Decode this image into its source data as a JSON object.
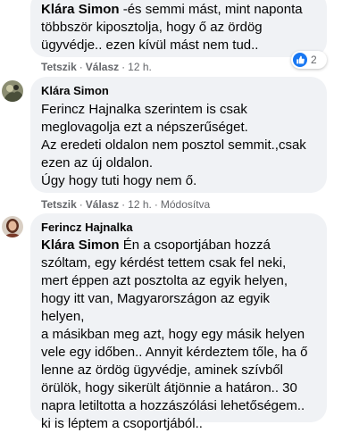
{
  "comments": [
    {
      "author": "Klára Simon",
      "first_line_rest": " -és semmi mást, mint naponta",
      "lines": [
        "többször kiposztolja, hogy ő az ördög",
        "ügyvédje.. ezen kívül mást nem tud.."
      ],
      "actions": {
        "like": "Tetszik",
        "reply": "Válasz",
        "time": "12 h."
      },
      "reaction": {
        "icon": "thumbs-up-icon",
        "count": "2"
      }
    },
    {
      "author": "Klára Simon",
      "lines": [
        "Ferincz Hajnalka szerintem is csak",
        "meglovagolja ezt a népszerűséget.",
        "Az eredeti oldalon nem posztol semmit.,csak",
        "ezen az új oldalon.",
        "Úgy hogy tuti hogy nem ő."
      ],
      "actions": {
        "like": "Tetszik",
        "reply": "Válasz",
        "time": "12 h.",
        "edited": "Módosítva"
      }
    },
    {
      "author": "Ferincz Hajnalka",
      "mention": "Klára Simon",
      "first_line_rest": " Én a csoportjában hozzá",
      "lines": [
        "szóltam, egy kérdést tettem csak fel neki,",
        "mert éppen azt posztolta az egyik helyen,",
        "hogy itt van, Magyarországon az egyik helyen,",
        "a másikban meg azt, hogy egy másik helyen",
        "vele egy időben.. Annyit kérdeztem tőle, ha ő",
        "lenne az ördög ügyvédje, aminek szívből",
        "örülök, hogy sikerült átjönnie a határon.. 30",
        "napra letiltotta a hozzászólási lehetőségem..",
        "ki is léptem a csoportjából.."
      ]
    }
  ],
  "colors": {
    "bubble": "#f0f2f5",
    "text": "#050505",
    "meta": "#65676b",
    "like_blue": "#1877f2"
  }
}
